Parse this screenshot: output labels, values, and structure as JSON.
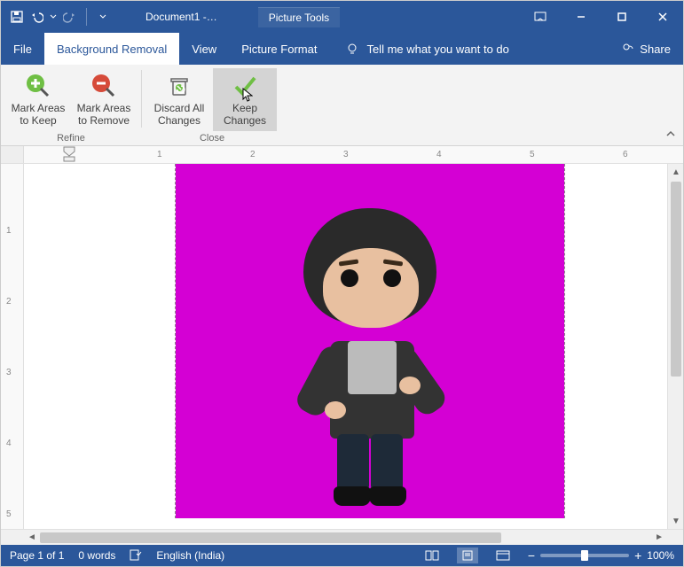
{
  "titlebar": {
    "doc_title": "Document1  -…",
    "context_tab": "Picture Tools"
  },
  "tabs": {
    "file": "File",
    "background_removal": "Background Removal",
    "view": "View",
    "picture_format": "Picture Format",
    "tell_me": "Tell me what you want to do",
    "share": "Share"
  },
  "ribbon": {
    "refine": {
      "label": "Refine",
      "mark_keep": "Mark Areas to Keep",
      "mark_remove": "Mark Areas to Remove"
    },
    "close": {
      "label": "Close",
      "discard": "Discard All Changes",
      "keep": "Keep Changes"
    }
  },
  "ruler": {
    "h_marks": [
      "1",
      "2",
      "3",
      "4",
      "5",
      "6"
    ],
    "v_marks": [
      "1",
      "2",
      "3",
      "4",
      "5"
    ]
  },
  "status": {
    "page": "Page 1 of 1",
    "words": "0 words",
    "language": "English (India)",
    "zoom": "100%"
  },
  "colors": {
    "brand": "#2b579a",
    "bg_remove": "#d400d4"
  }
}
